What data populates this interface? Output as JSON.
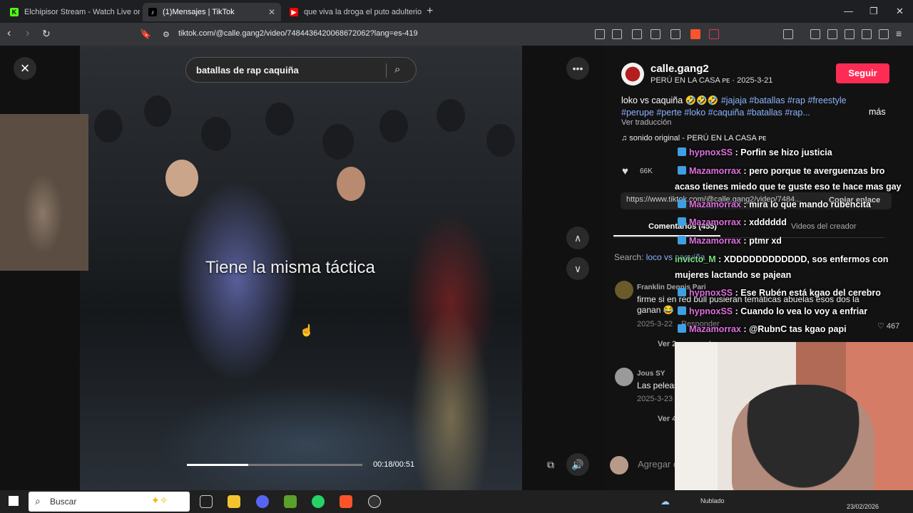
{
  "browser": {
    "tabs": [
      {
        "title": "Elchipisor Stream - Watch Live on Kick",
        "active": false
      },
      {
        "title": "(1)Mensajes | TikTok",
        "active": true
      },
      {
        "title": "que viva la droga el puto adulterio fe",
        "active": false
      }
    ],
    "url": "tiktok.com/@calle.gang2/video/7484436420068672062?lang=es-419"
  },
  "video": {
    "search_query": "batallas de rap caquiña",
    "caption": "Tiene la misma táctica",
    "time": "00:18/00:51",
    "progress": 0.35
  },
  "post": {
    "username": "calle.gang2",
    "subtitle": "PERÚ EN LA CASA ᴘᴇ · 2025-3-21",
    "follow_label": "Seguir",
    "desc_text": "loko vs caquiña 🤣🤣🤣 ",
    "desc_tags": "#jajaja #batallas #rap #freestyle #perupe #perte #loko #caquiña #batallas #rap...",
    "more_label": "más",
    "translate_label": "Ver traducción",
    "sound": "♫  sonido original - PERÚ EN LA CASA ᴘᴇ",
    "likes": "66K",
    "link": "https://www.tiktok.com/@calle.gang2/video/7484...",
    "copy_link": "Copiar enlace",
    "tab_comments": "Comentarios (455)",
    "tab_creator": "Videos del creador",
    "search_prefix": "Search: ",
    "search_term": "loco vs caquiña",
    "add_comment": "Agregar comentario..."
  },
  "comments": [
    {
      "name": "Franklin Dennis Pari",
      "text": "firme si en red bull pusieran temáticas abuelas esos dos la ganan 😂",
      "date": "2025-3-22",
      "reply": "Responder",
      "view": "Ver 2 respuestas"
    },
    {
      "name": "Jous SY",
      "text": "Las peleas",
      "date": "2025-3-23",
      "view": "Ver 4 respuestas"
    }
  ],
  "stream_chat": [
    {
      "nick": "hypnoxSS",
      "msg": "Porfin se hizo justicia"
    },
    {
      "nick": "Mazamorrax",
      "msg": "pero porque te averguenzas bro acaso tienes miedo que te guste eso te hace mas gay"
    },
    {
      "nick": "Mazamorrax",
      "msg": "mira lo que mando rubencita"
    },
    {
      "nick": "Mazamorrax",
      "msg": "xdddddd"
    },
    {
      "nick": "Mazamorrax",
      "msg": "ptmr xd"
    },
    {
      "nick": "invicto_M",
      "msg": "XDDDDDDDDDDDD, sos enfermos con mujeres lactando se pajean"
    },
    {
      "nick": "hypnoxSS",
      "msg": "Ese Rubén está kgao del cerebro"
    },
    {
      "nick": "hypnoxSS",
      "msg": "Cuando lo vea lo voy a enfriar"
    },
    {
      "nick": "Mazamorrax",
      "msg": "@RubnC tas kgao papi"
    }
  ],
  "chat_like_count": "467",
  "taskbar": {
    "search_placeholder": "Buscar",
    "weather": "Nublado",
    "date": "23/02/2026"
  }
}
